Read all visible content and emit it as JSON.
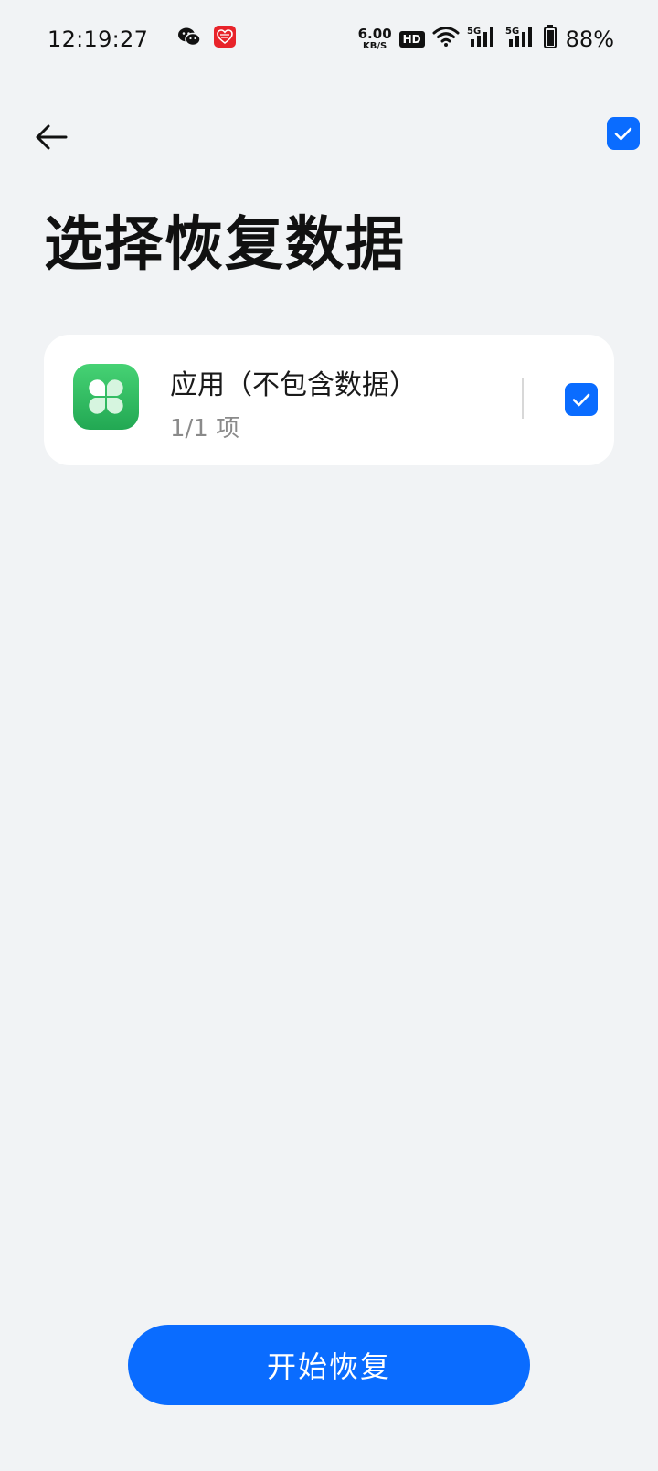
{
  "status_bar": {
    "time": "12:19:27",
    "notification_icons": [
      "wechat-icon",
      "red-app-icon"
    ],
    "net_speed_value": "6.00",
    "net_speed_unit": "KB/S",
    "hd_label": "HD",
    "battery_percent": "88%"
  },
  "header": {
    "back_icon": "back-arrow-icon",
    "select_all_checked": true
  },
  "title": "选择恢复数据",
  "items": [
    {
      "icon": "app-grid-icon",
      "title": "应用（不包含数据）",
      "subtitle": "1/1 项",
      "checked": true
    }
  ],
  "footer": {
    "start_button_label": "开始恢复"
  },
  "colors": {
    "accent": "#0A6CFF",
    "background": "#F1F3F5",
    "card": "#FFFFFF",
    "app_icon_green": "#34C464"
  }
}
